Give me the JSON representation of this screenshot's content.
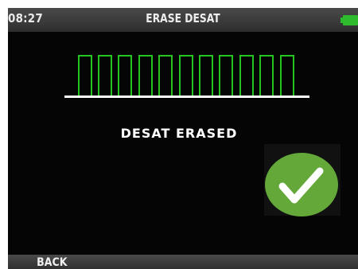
{
  "status_bar": {
    "time": "08:27",
    "title": "ERASE DESAT",
    "battery_icon": "battery-full-icon",
    "battery_color": "#2dbb2d"
  },
  "pin_entry": {
    "box_count": 11,
    "box_color": "#25c41e",
    "underline_color": "#ffffff"
  },
  "message": "DESAT ERASED",
  "confirmation": {
    "icon": "checkmark-icon",
    "circle_color": "#63a839",
    "check_color": "#ffffff"
  },
  "softkeys": {
    "back_label": "BACK"
  }
}
